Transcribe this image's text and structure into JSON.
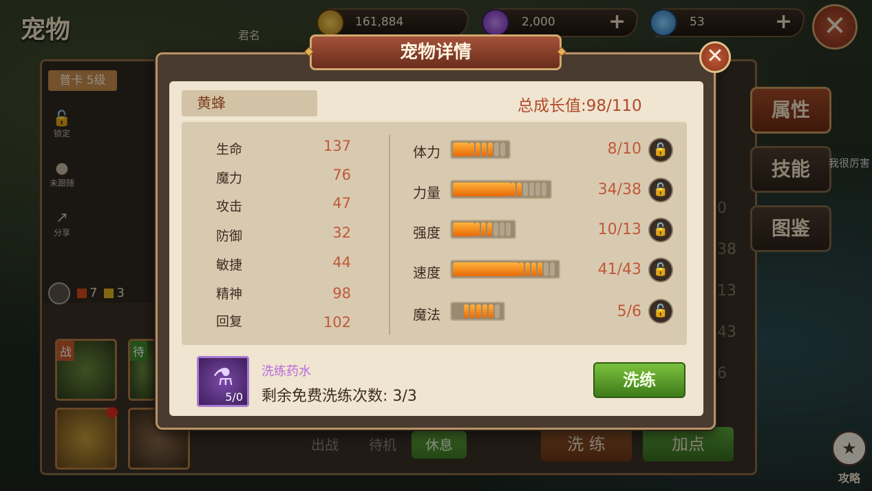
{
  "page_title": "宠物",
  "resources": {
    "gold": "161,884",
    "gem_purple": "2,000",
    "diamond": "53",
    "plus": "+"
  },
  "close_glyph": "✕",
  "player_label": "君名",
  "card": {
    "rank": "普卡",
    "level": "5级"
  },
  "side_actions": [
    {
      "icon": "lock-icon",
      "label": "锁定"
    },
    {
      "icon": "paw-icon",
      "label": "未跟随"
    },
    {
      "icon": "share-icon",
      "label": "分享"
    }
  ],
  "counts": {
    "red": "7",
    "yellow": "3"
  },
  "slot_tags": {
    "battle": "战",
    "standby": "待"
  },
  "right_tabs": [
    "属性",
    "技能",
    "图鉴"
  ],
  "bg_text": {
    "snippet": "我很厉害",
    "values": [
      "0",
      "38",
      "13",
      "43",
      "6"
    ]
  },
  "bottom_tabs": [
    "出战",
    "待机",
    "休息"
  ],
  "bottom_buttons": {
    "refine": "洗 练",
    "add_points": "加点"
  },
  "guide": "攻略",
  "modal": {
    "title": "宠物详情",
    "pet_name": "黄蜂",
    "growth_label": "总成长值:",
    "growth_value": "98/110",
    "stats": [
      {
        "label": "生命",
        "value": "137"
      },
      {
        "label": "魔力",
        "value": "76"
      },
      {
        "label": "攻击",
        "value": "47"
      },
      {
        "label": "防御",
        "value": "32"
      },
      {
        "label": "敏捷",
        "value": "44"
      },
      {
        "label": "精神",
        "value": "98"
      },
      {
        "label": "回复",
        "value": "102"
      }
    ],
    "aptitudes": [
      {
        "label": "体力",
        "current": 8,
        "max": 10,
        "text": "8/10"
      },
      {
        "label": "力量",
        "current": 34,
        "max": 38,
        "text": "34/38"
      },
      {
        "label": "强度",
        "current": 10,
        "max": 13,
        "text": "10/13"
      },
      {
        "label": "速度",
        "current": 41,
        "max": 43,
        "text": "41/43"
      },
      {
        "label": "魔法",
        "current": 5,
        "max": 6,
        "text": "5/6"
      }
    ],
    "item": {
      "name": "洗练药水",
      "count": "5/0"
    },
    "free_refines": "剩余免费洗练次数: 3/3",
    "refine_button": "洗练"
  },
  "colors": {
    "accent_orange": "#e86a08",
    "value_red": "#c0583a",
    "green_button": "#5ea83a",
    "potion_purple": "#b86ae0"
  }
}
